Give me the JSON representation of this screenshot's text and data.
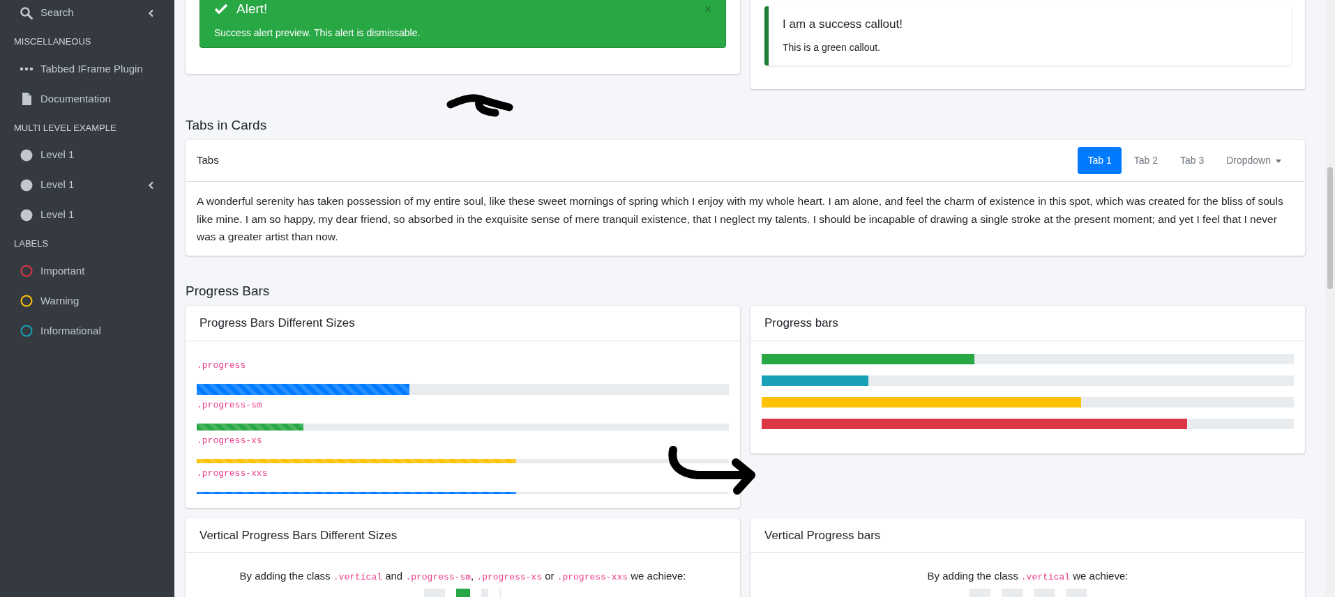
{
  "sidebar": {
    "items": [
      {
        "kind": "search",
        "label": "Search",
        "arrow": true
      },
      {
        "kind": "header",
        "label": "MISCELLANEOUS"
      },
      {
        "kind": "plugin",
        "label": "Tabbed IFrame Plugin",
        "arrow": false
      },
      {
        "kind": "document",
        "label": "Documentation",
        "arrow": false
      },
      {
        "kind": "header",
        "label": "MULTI LEVEL EXAMPLE"
      },
      {
        "kind": "level",
        "label": "Level 1",
        "arrow": false
      },
      {
        "kind": "level",
        "label": "Level 1",
        "arrow": true
      },
      {
        "kind": "level",
        "label": "Level 1",
        "arrow": false
      },
      {
        "kind": "header",
        "label": "LABELS"
      },
      {
        "kind": "label",
        "label": "Important",
        "color": "#dc3545"
      },
      {
        "kind": "label",
        "label": "Warning",
        "color": "#ffc107"
      },
      {
        "kind": "label",
        "label": "Informational",
        "color": "#17a2b8"
      }
    ]
  },
  "alert": {
    "title": "Alert!",
    "text": "Success alert preview. This alert is dismissable.",
    "close": "×"
  },
  "callout": {
    "title": "I am a success callout!",
    "text": "This is a green callout."
  },
  "tabs_section": {
    "heading": "Tabs in Cards",
    "card_title": "Tabs",
    "tabs": [
      {
        "label": "Tab 1",
        "selected": true
      },
      {
        "label": "Tab 2",
        "selected": false
      },
      {
        "label": "Tab 3",
        "selected": false
      },
      {
        "label": "Dropdown",
        "selected": false,
        "kind": "dropdown"
      }
    ],
    "text": "A wonderful serenity has taken possession of my entire soul, like these sweet mornings of spring which I enjoy with my whole heart. I am alone, and feel the charm of existence in this spot, which was created for the bliss of souls like mine. I am so happy, my dear friend, so absorbed in the exquisite sense of mere tranquil existence, that I neglect my talents. I should be incapable of drawing a single stroke at the present moment; and yet I feel that I never was a greater artist than now."
  },
  "progress_section": {
    "heading": "Progress Bars",
    "sizes_card": {
      "title": "Progress Bars Different Sizes",
      "bars": [
        {
          "label": ".progress",
          "kind": "md",
          "color": "#007bff",
          "level": 0.4
        },
        {
          "label": ".progress-sm",
          "kind": "sm",
          "color": "#28a745",
          "level": 0.2
        },
        {
          "label": ".progress-xs",
          "kind": "xs",
          "color": "#ffc107",
          "level": 0.6
        },
        {
          "label": ".progress-xxs",
          "kind": "xxs",
          "color": "#007bff",
          "level": 0.6
        }
      ]
    },
    "bars_card": {
      "title": "Progress bars",
      "bars": [
        {
          "color": "#28a745",
          "level": 0.4
        },
        {
          "color": "#17a2b8",
          "level": 0.2
        },
        {
          "color": "#ffc107",
          "level": 0.6
        },
        {
          "color": "#dc3545",
          "level": 0.8
        }
      ]
    },
    "vertical_sizes_card": {
      "title": "Vertical Progress Bars Different Sizes",
      "text": [
        {
          "kind": "text",
          "value": "By adding the class "
        },
        {
          "kind": "code",
          "value": ".vertical"
        },
        {
          "kind": "text",
          "value": " and "
        },
        {
          "kind": "code",
          "value": ".progress-sm"
        },
        {
          "kind": "text",
          "value": ", "
        },
        {
          "kind": "code",
          "value": ".progress-xs"
        },
        {
          "kind": "text",
          "value": " or "
        },
        {
          "kind": "code",
          "value": ".progress-xxs"
        },
        {
          "kind": "text",
          "value": " we achieve:"
        }
      ],
      "bars": [
        {
          "kind": "md",
          "color": "#e9ecef"
        },
        {
          "kind": "sm",
          "color": "#28a745"
        },
        {
          "kind": "xs",
          "color": "#e9ecef"
        },
        {
          "kind": "xxs",
          "color": "#e9ecef"
        }
      ]
    },
    "vertical_card": {
      "title": "Vertical Progress bars",
      "text": [
        {
          "kind": "text",
          "value": "By adding the class "
        },
        {
          "kind": "code",
          "value": ".vertical"
        },
        {
          "kind": "text",
          "value": " we achieve:"
        }
      ],
      "bars": [
        {
          "kind": "md",
          "color": "#e9ecef"
        },
        {
          "kind": "md",
          "color": "#e9ecef"
        },
        {
          "kind": "md",
          "color": "#e9ecef"
        },
        {
          "kind": "md",
          "color": "#e9ecef"
        }
      ]
    }
  }
}
